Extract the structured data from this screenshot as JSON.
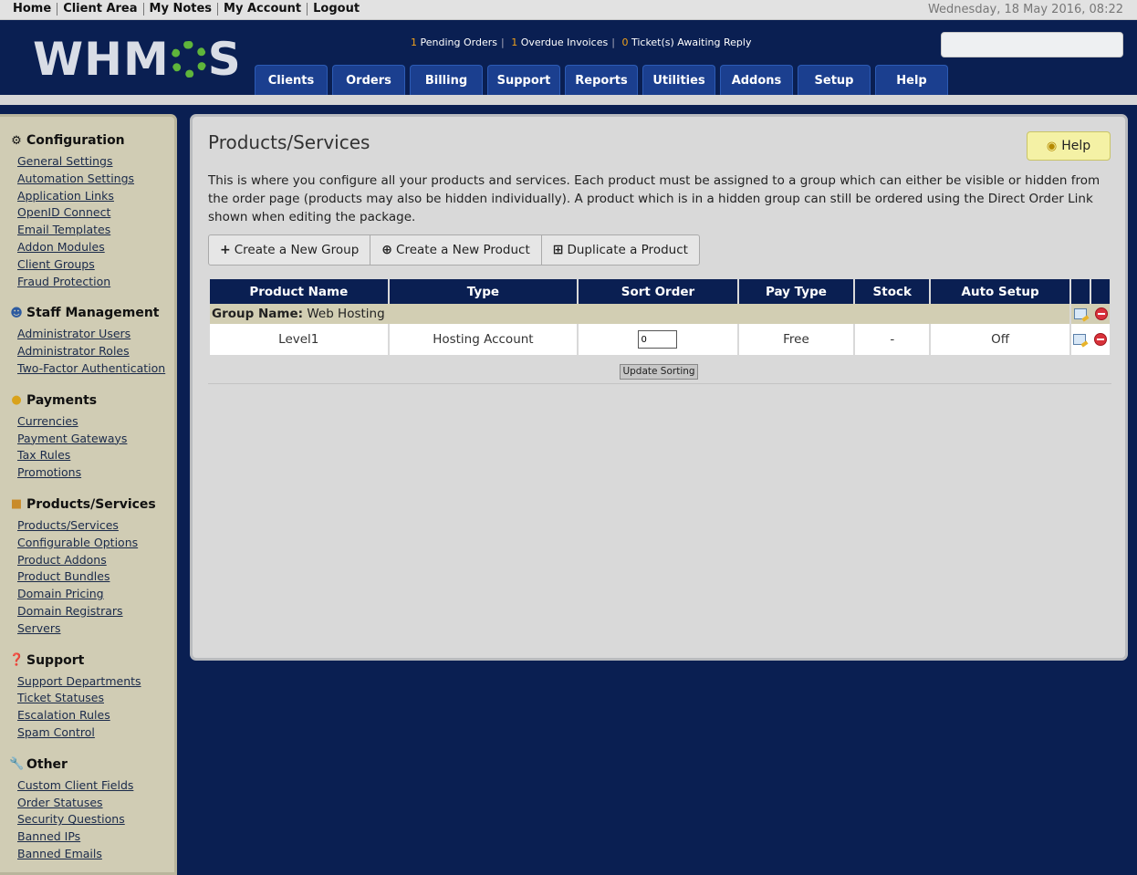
{
  "topnav": {
    "links": [
      "Home",
      "Client Area",
      "My Notes",
      "My Account",
      "Logout"
    ],
    "datetime": "Wednesday, 18 May 2016, 08:22"
  },
  "header": {
    "logo_left": "WHM",
    "logo_right": "S",
    "alerts": [
      {
        "count": "1",
        "label": "Pending Orders"
      },
      {
        "count": "1",
        "label": "Overdue Invoices"
      },
      {
        "count": "0",
        "label": "Ticket(s) Awaiting Reply"
      }
    ],
    "search_placeholder": "",
    "tabs": [
      "Clients",
      "Orders",
      "Billing",
      "Support",
      "Reports",
      "Utilities",
      "Addons",
      "Setup",
      "Help"
    ]
  },
  "sidebar": {
    "sections": [
      {
        "title": "Configuration",
        "icon": "config-icon",
        "items": [
          "General Settings",
          "Automation Settings",
          "Application Links",
          "OpenID Connect",
          "Email Templates",
          "Addon Modules",
          "Client Groups",
          "Fraud Protection"
        ]
      },
      {
        "title": "Staff Management",
        "icon": "staff-icon",
        "items": [
          "Administrator Users",
          "Administrator Roles",
          "Two-Factor Authentication"
        ]
      },
      {
        "title": "Payments",
        "icon": "coins-icon",
        "items": [
          "Currencies",
          "Payment Gateways",
          "Tax Rules",
          "Promotions"
        ]
      },
      {
        "title": "Products/Services",
        "icon": "box-icon",
        "items": [
          "Products/Services",
          "Configurable Options",
          "Product Addons",
          "Product Bundles",
          "Domain Pricing",
          "Domain Registrars",
          "Servers"
        ]
      },
      {
        "title": "Support",
        "icon": "help-circle-icon",
        "items": [
          "Support Departments",
          "Ticket Statuses",
          "Escalation Rules",
          "Spam Control"
        ]
      },
      {
        "title": "Other",
        "icon": "wrench-icon",
        "items": [
          "Custom Client Fields",
          "Order Statuses",
          "Security Questions",
          "Banned IPs",
          "Banned Emails"
        ]
      }
    ]
  },
  "main": {
    "title": "Products/Services",
    "help_label": "Help",
    "intro": "This is where you configure all your products and services. Each product must be assigned to a group which can either be visible or hidden from the order page (products may also be hidden individually). A product which is in a hidden group can still be ordered using the Direct Order Link shown when editing the package.",
    "actions": [
      "Create a New Group",
      "Create a New Product",
      "Duplicate a Product"
    ],
    "table": {
      "headers": [
        "Product Name",
        "Type",
        "Sort Order",
        "Pay Type",
        "Stock",
        "Auto Setup"
      ],
      "group_label": "Group Name:",
      "group_name": "Web Hosting",
      "rows": [
        {
          "name": "Level1",
          "type": "Hosting Account",
          "sort_order": "0",
          "pay_type": "Free",
          "stock": "-",
          "auto_setup": "Off"
        }
      ]
    },
    "update_label": "Update Sorting"
  }
}
